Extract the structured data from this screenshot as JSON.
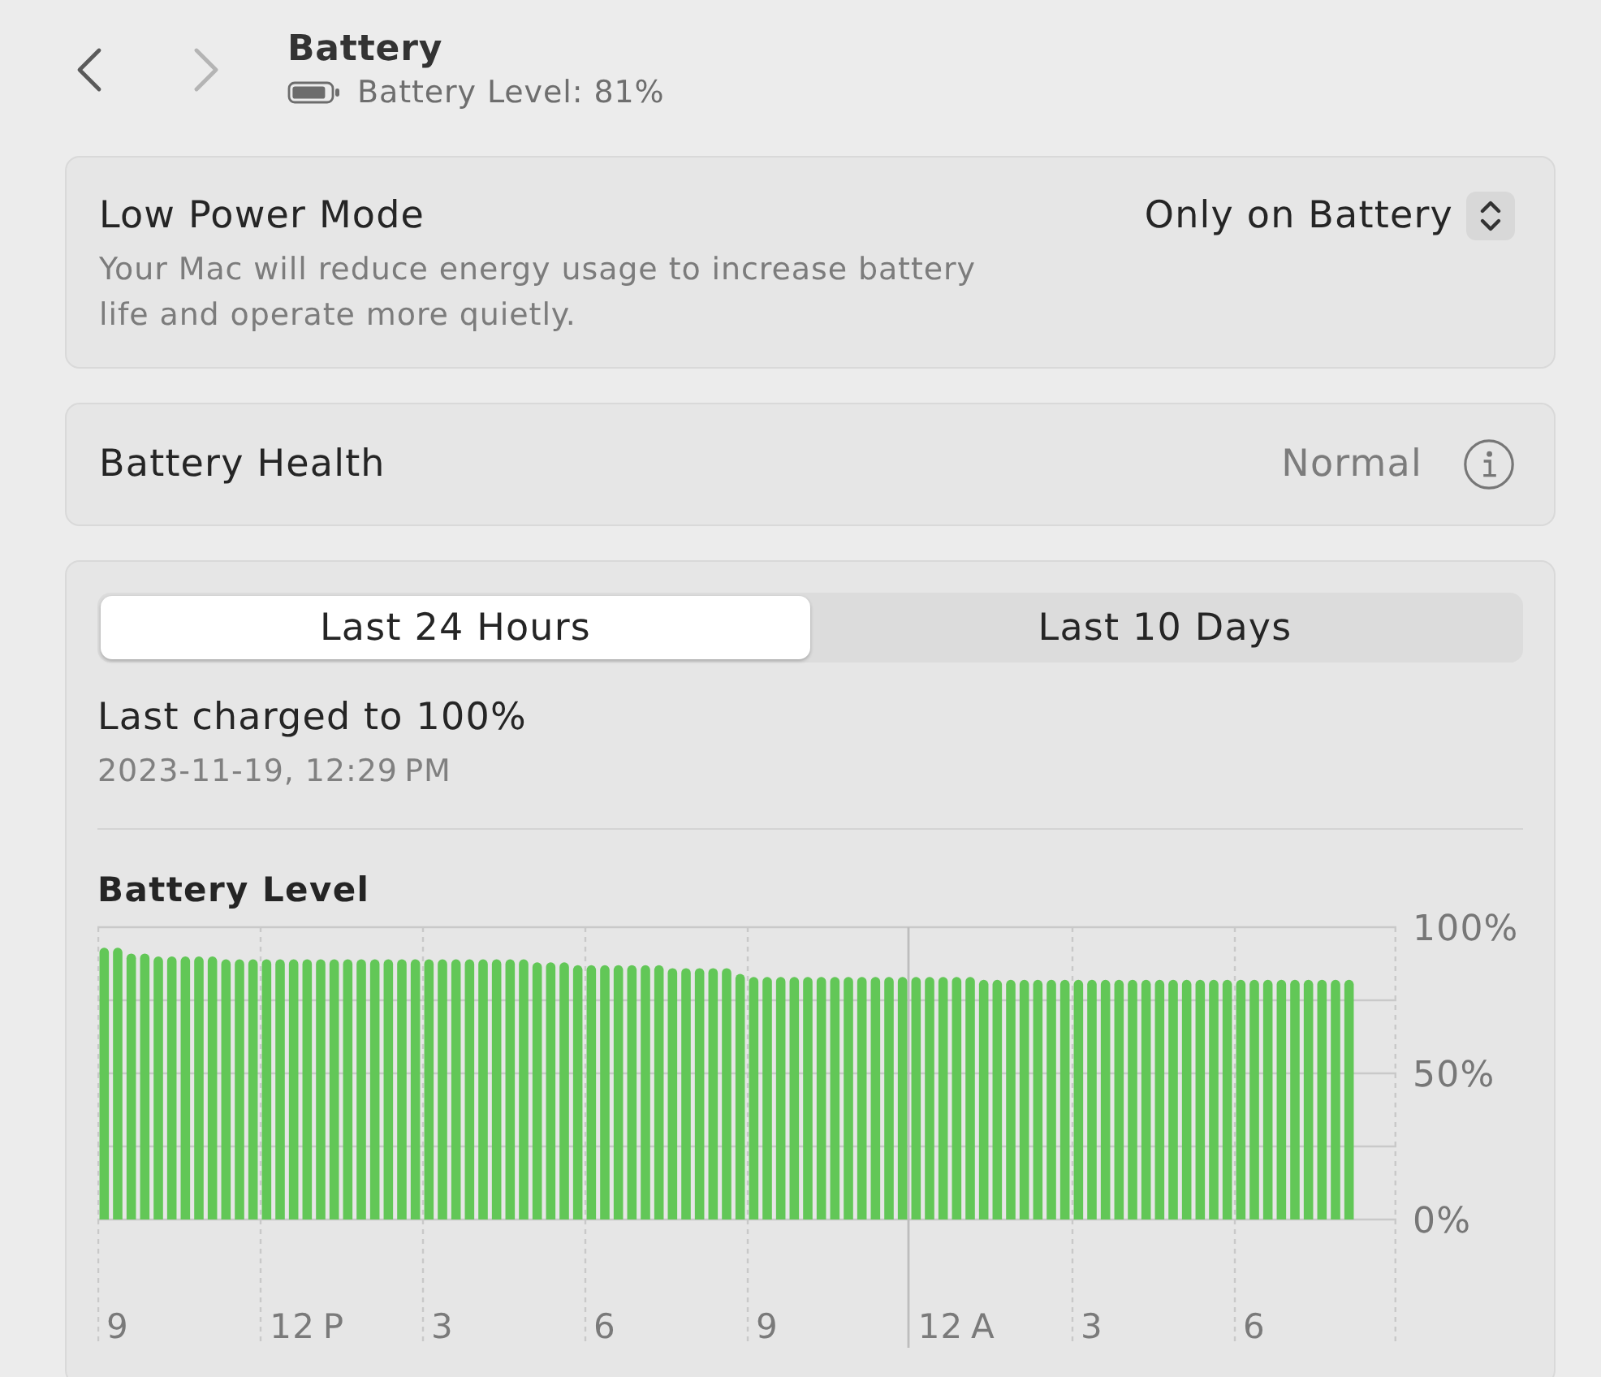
{
  "navigation": [
    {
      "kind": "back",
      "disabled": false
    },
    {
      "kind": "forward",
      "disabled": true
    }
  ],
  "header": {
    "title": "Battery",
    "battery_level": "Battery Level: 81%"
  },
  "low_power_mode": {
    "label": "Low Power Mode",
    "description": "Your Mac will reduce energy usage to increase battery life and operate more quietly.",
    "value": "Only on Battery"
  },
  "battery_health": {
    "label": "Battery Health",
    "value": "Normal"
  },
  "usage": {
    "tabs": [
      {
        "label": "Last 24 Hours",
        "selected": true
      },
      {
        "label": "Last 10 Days",
        "selected": false
      }
    ],
    "last_charged": "Last charged to 100%",
    "charged_at": "2023-11-19, 12:29 PM",
    "chart_data": {
      "type": "bar",
      "title": "Battery Level",
      "categories": [
        null,
        "9",
        null,
        null,
        null,
        null,
        null,
        null,
        null,
        null,
        null,
        null,
        null,
        null,
        null,
        "12 P",
        null,
        null,
        null,
        null,
        null,
        null,
        null,
        null,
        null,
        "3",
        null,
        null,
        null,
        null,
        null,
        null,
        null,
        null,
        null,
        null,
        null,
        "6",
        null,
        null,
        null,
        null,
        null,
        null,
        null,
        null,
        null,
        null,
        null,
        "9",
        null,
        null,
        null,
        null,
        null,
        null,
        null,
        null,
        null,
        null,
        null,
        null,
        null,
        "12 A",
        null,
        null,
        null,
        null,
        null,
        null,
        null,
        null,
        null,
        "3",
        null,
        null,
        null,
        null,
        null,
        null,
        null,
        null,
        null,
        null,
        null,
        "6",
        null,
        null,
        null,
        null,
        null,
        null,
        null,
        null,
        null,
        null
      ],
      "values": [
        93,
        93,
        91,
        91,
        90,
        90,
        90,
        90,
        90,
        89,
        89,
        89,
        89,
        89,
        89,
        89,
        89,
        89,
        89,
        89,
        89,
        89,
        89,
        89,
        89,
        89,
        89,
        89,
        89,
        89,
        89,
        89,
        88,
        88,
        88,
        87,
        87,
        87,
        87,
        87,
        87,
        87,
        86,
        86,
        86,
        86,
        86,
        84,
        83,
        83,
        83,
        83,
        83,
        83,
        83,
        83,
        83,
        83,
        83,
        83,
        83,
        83,
        83,
        83,
        83,
        82,
        82,
        82,
        82,
        82,
        82,
        82,
        82,
        82,
        82,
        82,
        82,
        82,
        82,
        82,
        82,
        82,
        82,
        82,
        82,
        82,
        82,
        82,
        82,
        82,
        82,
        82,
        82,
        null,
        null,
        null
      ],
      "ylim": [
        0,
        100
      ],
      "yticks": [
        {
          "value": 0,
          "label": "0%"
        },
        {
          "value": 50,
          "label": "50%"
        },
        {
          "value": 100,
          "label": "100%"
        }
      ],
      "grid": true
    }
  }
}
